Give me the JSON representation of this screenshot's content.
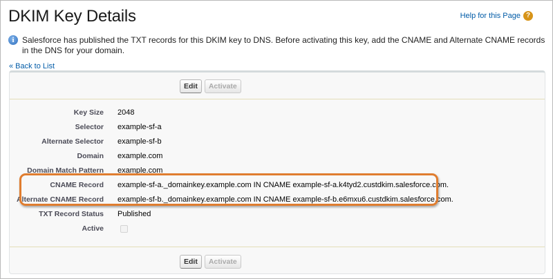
{
  "page": {
    "title": "DKIM Key Details",
    "help_link": "Help for this Page",
    "help_icon_glyph": "?",
    "info_icon_glyph": "i",
    "info_message": "Salesforce has published the TXT records for this DKIM key to DNS. Before activating this key, add the CNAME and Alternate CNAME records in the DNS for your domain.",
    "back_link": "« Back to List"
  },
  "buttons": {
    "edit": "Edit",
    "activate": "Activate"
  },
  "fields": {
    "key_size": {
      "label": "Key Size",
      "value": "2048"
    },
    "selector": {
      "label": "Selector",
      "value": "example-sf-a"
    },
    "alt_selector": {
      "label": "Alternate Selector",
      "value": "example-sf-b"
    },
    "domain": {
      "label": "Domain",
      "value": "example.com"
    },
    "domain_match": {
      "label": "Domain Match Pattern",
      "value": "example.com"
    },
    "cname": {
      "label": "CNAME Record",
      "value": "example-sf-a._domainkey.example.com IN CNAME example-sf-a.k4tyd2.custdkim.salesforce.com."
    },
    "alt_cname": {
      "label": "Alternate CNAME Record",
      "value": "example-sf-b._domainkey.example.com IN CNAME example-sf-b.e6mxu6.custdkim.salesforce.com."
    },
    "txt_status": {
      "label": "TXT Record Status",
      "value": "Published"
    },
    "active": {
      "label": "Active",
      "checked": false
    }
  },
  "colors": {
    "link": "#015ba7",
    "highlight": "#e07d2f",
    "help_icon": "#d79419",
    "info_icon": "#2f6fbd"
  }
}
